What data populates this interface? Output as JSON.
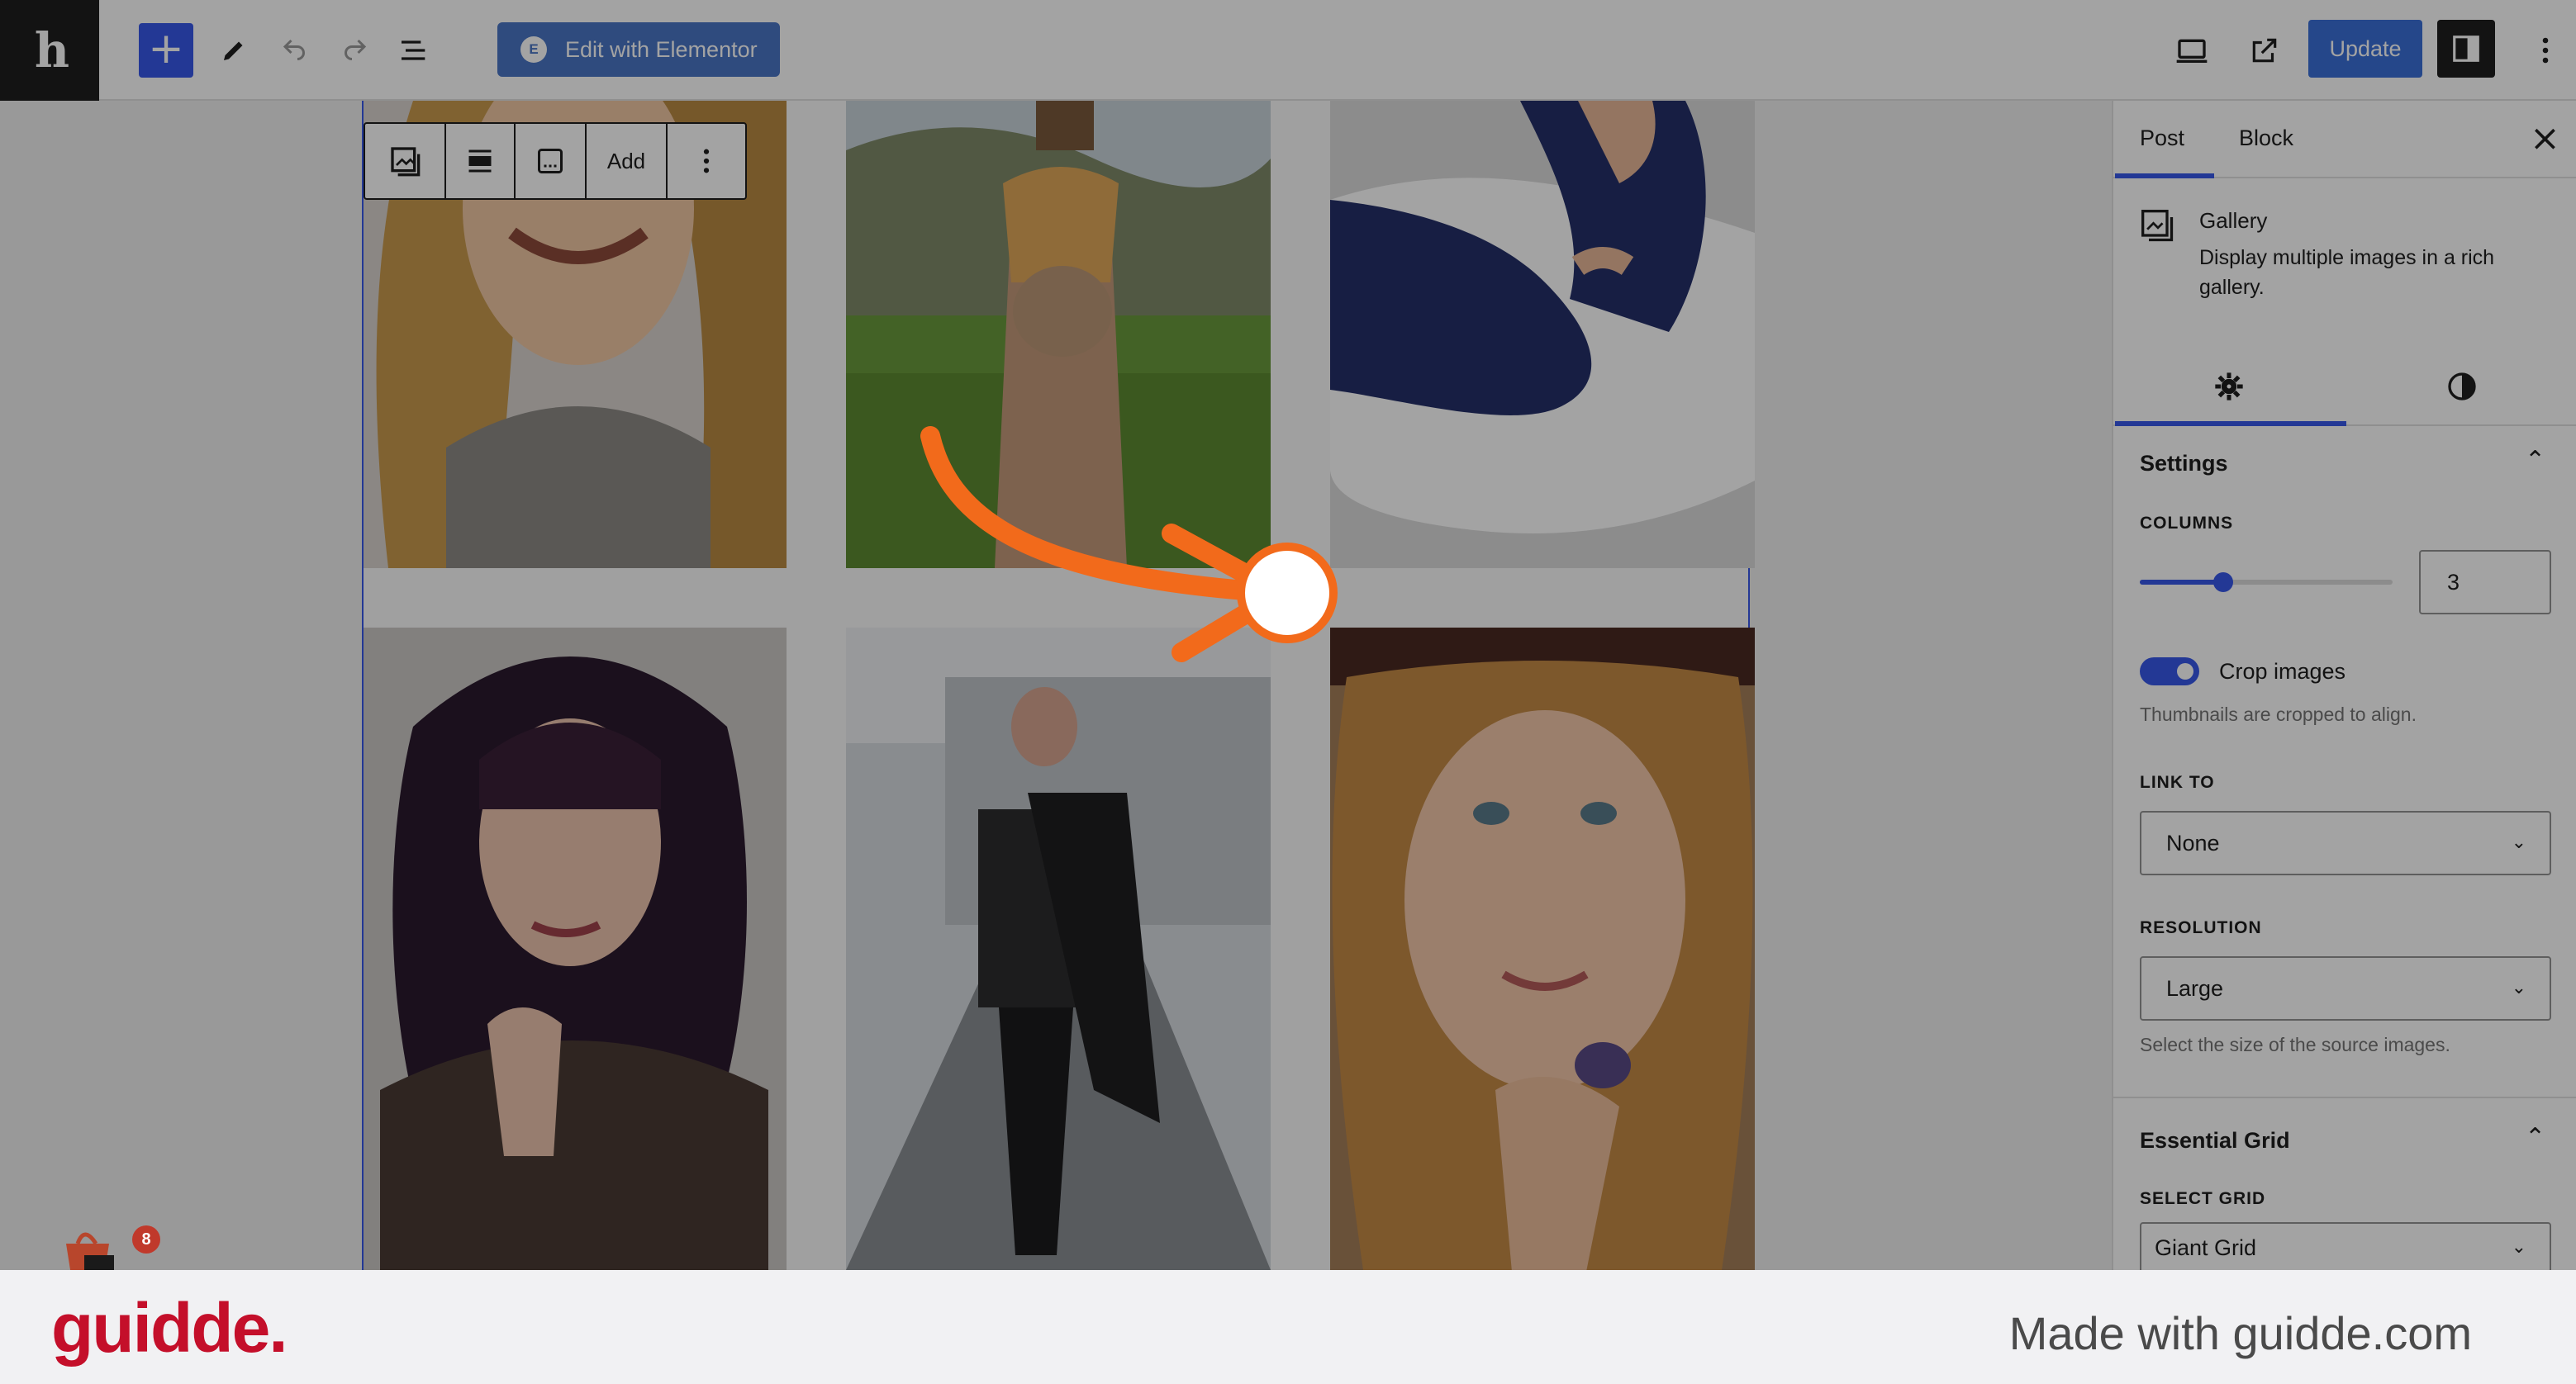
{
  "toolbar": {
    "logo_text": "h",
    "elementor_label": "Edit with Elementor",
    "elementor_logo": "E",
    "update_label": "Update",
    "icons": [
      "add-block-icon",
      "pencil-tool-icon",
      "undo-icon",
      "redo-icon",
      "document-overview-icon",
      "desktop-preview-icon",
      "external-view-icon",
      "settings-sidebar-icon",
      "more-options-icon"
    ]
  },
  "block_toolbar": {
    "add_label": "Add",
    "icons": [
      "gallery-block-icon",
      "align-icon",
      "caption-icon",
      "more-vertical-icon"
    ]
  },
  "gallery": {
    "photos": [
      {
        "name": "woman-smiling-blonde",
        "alt": ""
      },
      {
        "name": "pregnant-woman-field",
        "alt": ""
      },
      {
        "name": "pregnant-woman-fur-rug",
        "alt": ""
      },
      {
        "name": "woman-dark-hair-jacket",
        "alt": ""
      },
      {
        "name": "woman-walking-black-coat",
        "alt": ""
      },
      {
        "name": "curly-hair-woman-hat",
        "alt": ""
      }
    ]
  },
  "sidebar": {
    "tabs": [
      "Post",
      "Block"
    ],
    "block_card": {
      "title": "Gallery",
      "description": "Display multiple images in a rich gallery."
    },
    "settings_panel": {
      "title": "Settings",
      "columns_label": "COLUMNS",
      "columns_value": "3",
      "columns_fraction": 0.33,
      "crop_label": "Crop images",
      "crop_enabled": true,
      "crop_help": "Thumbnails are cropped to align.",
      "link_label": "LINK TO",
      "link_value": "None",
      "resolution_label": "RESOLUTION",
      "resolution_value": "Large",
      "resolution_help": "Select the size of the source images."
    },
    "essential_grid_panel": {
      "title": "Essential Grid",
      "select_label": "SELECT GRID",
      "select_value": "Giant Grid"
    }
  },
  "cart_badge_count": "8",
  "footer": {
    "brand": "guidde.",
    "made_with": "Made with guidde.com"
  },
  "colors": {
    "accent": "#3858e9",
    "pointer": "#f26a1b",
    "brand": "#c40f2a"
  }
}
